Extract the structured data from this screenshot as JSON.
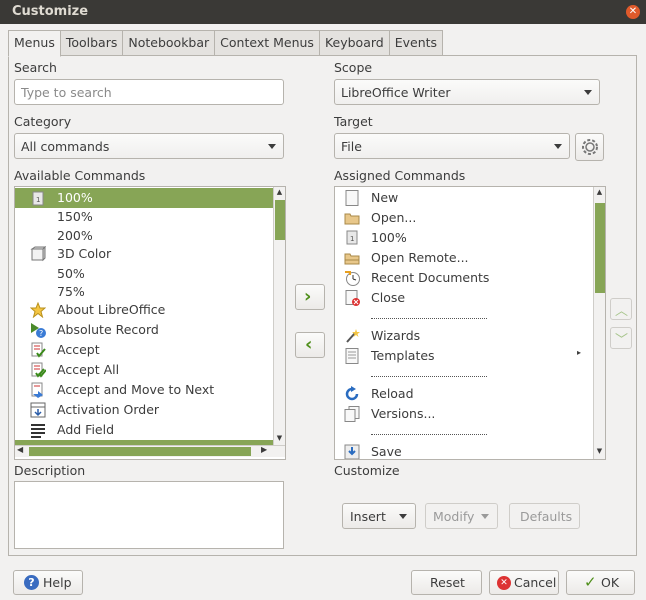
{
  "window": {
    "title": "Customize"
  },
  "tabs": [
    "Menus",
    "Toolbars",
    "Notebookbar",
    "Context Menus",
    "Keyboard",
    "Events"
  ],
  "search": {
    "label": "Search",
    "placeholder": "Type to search"
  },
  "category": {
    "label": "Category",
    "value": "All commands"
  },
  "available": {
    "label": "Available Commands",
    "items": [
      "100%",
      "150%",
      "200%",
      "3D Color",
      "50%",
      "75%",
      "About LibreOffice",
      "Absolute Record",
      "Accept",
      "Accept All",
      "Accept and Move to Next",
      "Activation Order",
      "Add Field"
    ]
  },
  "scope": {
    "label": "Scope",
    "value": "LibreOffice Writer"
  },
  "target": {
    "label": "Target",
    "value": "File"
  },
  "assigned": {
    "label": "Assigned Commands",
    "items": [
      "New",
      "Open...",
      "100%",
      "Open Remote...",
      "Recent Documents",
      "Close",
      "",
      "Wizards",
      "Templates",
      "",
      "Reload",
      "Versions...",
      "",
      "Save"
    ]
  },
  "description": {
    "label": "Description"
  },
  "customize": {
    "label": "Customize",
    "insert": "Insert",
    "modify": "Modify",
    "defaults": "Defaults"
  },
  "footer": {
    "help": "Help",
    "reset": "Reset",
    "cancel": "Cancel",
    "ok": "OK"
  },
  "colors": {
    "accent": "#87a556",
    "titlebar": "#3a3936"
  }
}
